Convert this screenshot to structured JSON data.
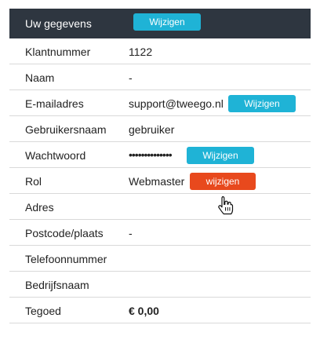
{
  "header": {
    "title": "Uw gegevens",
    "edit_label": "Wijzigen"
  },
  "rows": [
    {
      "label": "Klantnummer",
      "value": "1122"
    },
    {
      "label": "Naam",
      "value": "-"
    },
    {
      "label": "E-mailadres",
      "value": "support@tweego.nl",
      "button": "Wijzigen"
    },
    {
      "label": "Gebruikersnaam",
      "value": "gebruiker"
    },
    {
      "label": "Wachtwoord",
      "value": "••••••••••••••",
      "button": "Wijzigen"
    },
    {
      "label": "Rol",
      "value": "Webmaster",
      "button": "wijzigen"
    },
    {
      "label": "Adres",
      "value": ""
    },
    {
      "label": "Postcode/plaats",
      "value": "-"
    },
    {
      "label": "Telefoonnummer",
      "value": ""
    },
    {
      "label": "Bedrijfsnaam",
      "value": ""
    },
    {
      "label": "Tegoed",
      "value": "€ 0,00"
    }
  ],
  "colors": {
    "header_bg": "#2e3640",
    "button_blue": "#1fb3d6",
    "button_red": "#e8491d"
  },
  "cursor_icon": "hand-pointer-icon"
}
